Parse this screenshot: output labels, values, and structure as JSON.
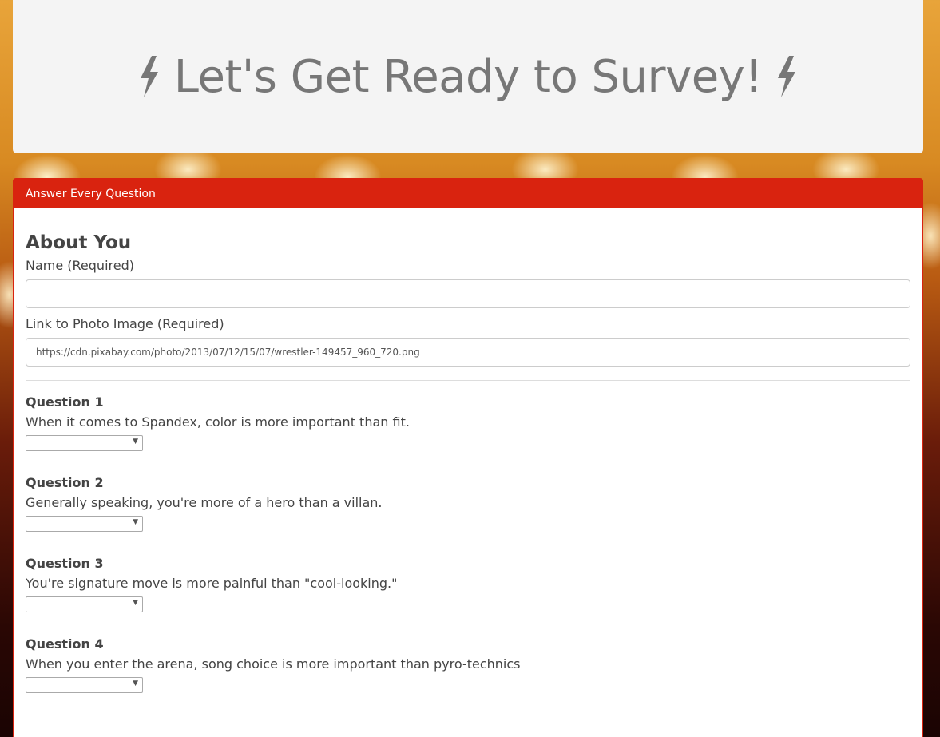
{
  "header": {
    "title": "Let's Get Ready to Survey!"
  },
  "panel": {
    "heading": "Answer Every Question"
  },
  "about": {
    "section_title": "About You",
    "name_label": "Name (Required)",
    "name_value": "",
    "photo_label": "Link to Photo Image (Required)",
    "photo_value": "https://cdn.pixabay.com/photo/2013/07/12/15/07/wrestler-149457_960_720.png"
  },
  "questions": [
    {
      "title": "Question 1",
      "text": "When it comes to Spandex, color is more important than fit.",
      "selected": ""
    },
    {
      "title": "Question 2",
      "text": "Generally speaking, you're more of a hero than a villan.",
      "selected": ""
    },
    {
      "title": "Question 3",
      "text": "You're signature move is more painful than \"cool-looking.\"",
      "selected": ""
    },
    {
      "title": "Question 4",
      "text": "When you enter the arena, song choice is more important than pyro-technics",
      "selected": ""
    }
  ],
  "icons": {
    "title_left": "bolt-icon",
    "title_right": "bolt-icon",
    "select_arrow": "chevron-down-icon"
  },
  "colors": {
    "accent": "#d9230f",
    "header_bg": "#f4f4f4",
    "title_text": "#777777"
  }
}
